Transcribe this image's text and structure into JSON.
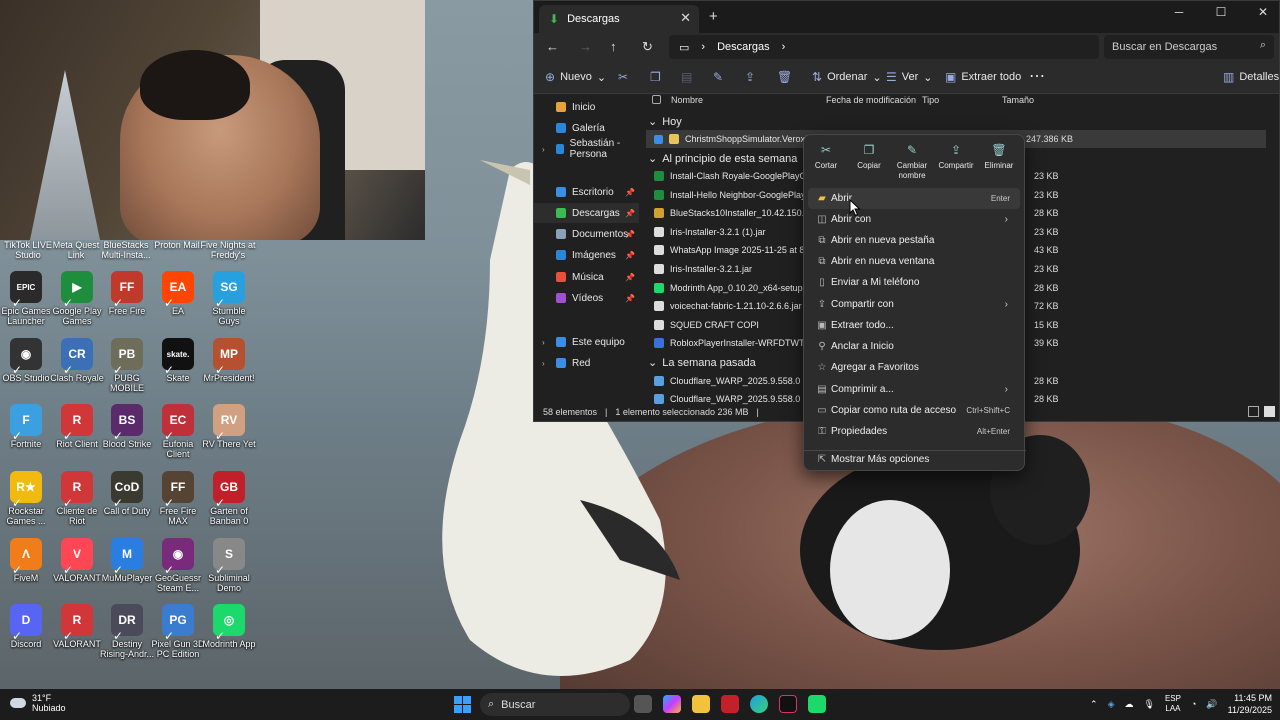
{
  "desktop_icons_top_row": [
    "TikTok LIVE Studio",
    "Meta Quest Link",
    "BlueStacks Multi-Insta...",
    "Proton Mail",
    "Five Nights at Freddy's"
  ],
  "desktop_icons": [
    {
      "label": "Epic Games Launcher",
      "glyph": "EPIC",
      "color": "#2a2a2a"
    },
    {
      "label": "Google Play Games",
      "glyph": "▶",
      "color": "#1e8e3e"
    },
    {
      "label": "Free Fire",
      "glyph": "FF",
      "color": "#c0392b"
    },
    {
      "label": "EA",
      "glyph": "EA",
      "color": "#ff4500"
    },
    {
      "label": "Stumble Guys",
      "glyph": "SG",
      "color": "#27a0e0"
    },
    {
      "label": "OBS Studio",
      "glyph": "◉",
      "color": "#333333"
    },
    {
      "label": "Clash Royale",
      "glyph": "CR",
      "color": "#3b6fb6"
    },
    {
      "label": "PUBG MOBILE",
      "glyph": "PB",
      "color": "#6d6d5a"
    },
    {
      "label": "Skate",
      "glyph": "skate.",
      "color": "#111111"
    },
    {
      "label": "MrPresident!",
      "glyph": "MP",
      "color": "#b55030"
    },
    {
      "label": "Fortnite",
      "glyph": "F",
      "color": "#3aa0e0"
    },
    {
      "label": "Riot Client",
      "glyph": "R",
      "color": "#d13639"
    },
    {
      "label": "Blood Strike",
      "glyph": "BS",
      "color": "#5a2a6a"
    },
    {
      "label": "Eufonia Client",
      "glyph": "EC",
      "color": "#c0303a"
    },
    {
      "label": "RV There Yet",
      "glyph": "RV",
      "color": "#d0a080"
    },
    {
      "label": "Rockstar Games ...",
      "glyph": "R★",
      "color": "#f2b90f"
    },
    {
      "label": "Cliente de Riot",
      "glyph": "R",
      "color": "#d13639"
    },
    {
      "label": "Call of Duty",
      "glyph": "CoD",
      "color": "#3a3a30"
    },
    {
      "label": "Free Fire MAX",
      "glyph": "FF",
      "color": "#554433"
    },
    {
      "label": "Garten of Banban 0",
      "glyph": "GB",
      "color": "#c0202a"
    },
    {
      "label": "FiveM",
      "glyph": "Λ",
      "color": "#f07d1a"
    },
    {
      "label": "VALORANT",
      "glyph": "V",
      "color": "#ff4655"
    },
    {
      "label": "MuMuPlayer",
      "glyph": "M",
      "color": "#2a7de1"
    },
    {
      "label": "GeoGuessr Steam E...",
      "glyph": "◉",
      "color": "#7a2a7a"
    },
    {
      "label": "Subliminal Demo",
      "glyph": "S",
      "color": "#888888"
    },
    {
      "label": "Discord",
      "glyph": "D",
      "color": "#5865f2"
    },
    {
      "label": "VALORANT",
      "glyph": "R",
      "color": "#d13639"
    },
    {
      "label": "Destiny Rising-Andr...",
      "glyph": "DR",
      "color": "#4a4a5a"
    },
    {
      "label": "Pixel Gun 3D PC Edition",
      "glyph": "PG",
      "color": "#3b7bd0"
    },
    {
      "label": "Modrinth App",
      "glyph": "◎",
      "color": "#1bd96a"
    }
  ],
  "explorer": {
    "tab_title": "Descargas",
    "path": "Descargas",
    "search_placeholder": "Buscar en Descargas",
    "toolbar": {
      "new": "Nuevo",
      "sort": "Ordenar",
      "view": "Ver",
      "extract_all": "Extraer todo",
      "details": "Detalles"
    },
    "sidebar": [
      {
        "label": "Inicio",
        "color": "#e8a23c"
      },
      {
        "label": "Galería",
        "color": "#2a86d8"
      },
      {
        "label": "Sebastián - Persona",
        "color": "#2a86d8"
      },
      {
        "label": "Escritorio",
        "color": "#3a8ee6"
      },
      {
        "label": "Descargas",
        "color": "#3cba54"
      },
      {
        "label": "Documentos",
        "color": "#8aa0b8"
      },
      {
        "label": "Imágenes",
        "color": "#2a86d8"
      },
      {
        "label": "Música",
        "color": "#e8503c"
      },
      {
        "label": "Vídeos",
        "color": "#a050d0"
      },
      {
        "label": "Este equipo",
        "color": "#3a8ee6"
      },
      {
        "label": "Red",
        "color": "#3a8ee6"
      }
    ],
    "columns": {
      "name": "Nombre",
      "date": "Fecha de modificación",
      "type": "Tipo",
      "size": "Tamaño"
    },
    "groups": {
      "today": "Hoy",
      "this_week": "Al principio de esta semana",
      "last_week": "La semana pasada"
    },
    "files_today": [
      {
        "name": "ChristmShoppSimulator.VeroxPiviGa",
        "size": "247.386 KB",
        "color": "#e8c45c"
      }
    ],
    "files_week": [
      {
        "name": "Install-Clash Royale-GooglePlayGam",
        "size": "23 KB",
        "color": "#1e8e3e"
      },
      {
        "name": "Install-Hello Neighbor-GooglePlayG",
        "size": "23 KB",
        "color": "#1e8e3e"
      },
      {
        "name": "BlueStacks10Installer_10.42.150.1001",
        "size": "28 KB",
        "color": "#d0a030"
      },
      {
        "name": "Iris-Installer-3.2.1 (1).jar",
        "size": "23 KB",
        "color": "#dddddd"
      },
      {
        "name": "WhatsApp Image 2025-11-25 at 8.11",
        "size": "43 KB",
        "color": "#dddddd"
      },
      {
        "name": "Iris-Installer-3.2.1.jar",
        "size": "23 KB",
        "color": "#dddddd"
      },
      {
        "name": "Modrinth App_0.10.20_x64-setup",
        "size": "28 KB",
        "color": "#1bd96a"
      },
      {
        "name": "voicechat-fabric-1.21.10-2.6.6.jar",
        "size": "72 KB",
        "color": "#dddddd"
      },
      {
        "name": "SQUED CRAFT COPI",
        "size": "15 KB",
        "color": "#dddddd"
      },
      {
        "name": "RobloxPlayerInstaller-WRFDTWTCD7",
        "size": "39 KB",
        "color": "#3b6fe0"
      }
    ],
    "files_lastweek": [
      {
        "name": "Cloudflare_WARP_2025.9.558.0 (1)",
        "size": "28 KB",
        "color": "#5aa0e0"
      },
      {
        "name": "Cloudflare_WARP_2025.9.558.0",
        "size": "28 KB",
        "color": "#5aa0e0"
      }
    ],
    "status": {
      "count": "58 elementos",
      "selected": "1 elemento seleccionado  236 MB"
    }
  },
  "context_menu": {
    "actions": [
      {
        "label": "Cortar",
        "icon": "scissors-icon",
        "glyph": "✂"
      },
      {
        "label": "Copiar",
        "icon": "copy-icon",
        "glyph": "❐"
      },
      {
        "label": "Cambiar nombre",
        "icon": "rename-icon",
        "glyph": "✎"
      },
      {
        "label": "Compartir",
        "icon": "share-icon",
        "glyph": "⇪"
      },
      {
        "label": "Eliminar",
        "icon": "trash-icon",
        "glyph": "🗑"
      }
    ],
    "items": [
      {
        "label": "Abrir",
        "shortcut": "Enter",
        "glyph": "▰",
        "submenu": false
      },
      {
        "label": "Abrir con",
        "shortcut": "",
        "glyph": "◫",
        "submenu": true
      },
      {
        "label": "Abrir en nueva pestaña",
        "shortcut": "",
        "glyph": "⧉",
        "submenu": false
      },
      {
        "label": "Abrir en nueva ventana",
        "shortcut": "",
        "glyph": "⧉",
        "submenu": false
      },
      {
        "label": "Enviar a Mi teléfono",
        "shortcut": "",
        "glyph": "▯",
        "submenu": false
      },
      {
        "label": "Compartir con",
        "shortcut": "",
        "glyph": "⇪",
        "submenu": true
      },
      {
        "label": "Extraer todo...",
        "shortcut": "",
        "glyph": "▣",
        "submenu": false
      },
      {
        "label": "Anclar a Inicio",
        "shortcut": "",
        "glyph": "⚲",
        "submenu": false
      },
      {
        "label": "Agregar a Favoritos",
        "shortcut": "",
        "glyph": "☆",
        "submenu": false
      },
      {
        "label": "Comprimir a...",
        "shortcut": "",
        "glyph": "▤",
        "submenu": true
      },
      {
        "label": "Copiar como ruta de acceso",
        "shortcut": "Ctrl+Shift+C",
        "glyph": "▭",
        "submenu": false
      },
      {
        "label": "Propiedades",
        "shortcut": "Alt+Enter",
        "glyph": "⚿",
        "submenu": false
      },
      {
        "label": "Mostrar Más opciones",
        "shortcut": "",
        "glyph": "⇱",
        "submenu": false
      }
    ]
  },
  "taskbar": {
    "weather_temp": "31°F",
    "weather_desc": "Nubiado",
    "search": "Buscar",
    "lang1": "ESP",
    "lang2": "LAA",
    "time": "11:45 PM",
    "date": "11/29/2025"
  }
}
